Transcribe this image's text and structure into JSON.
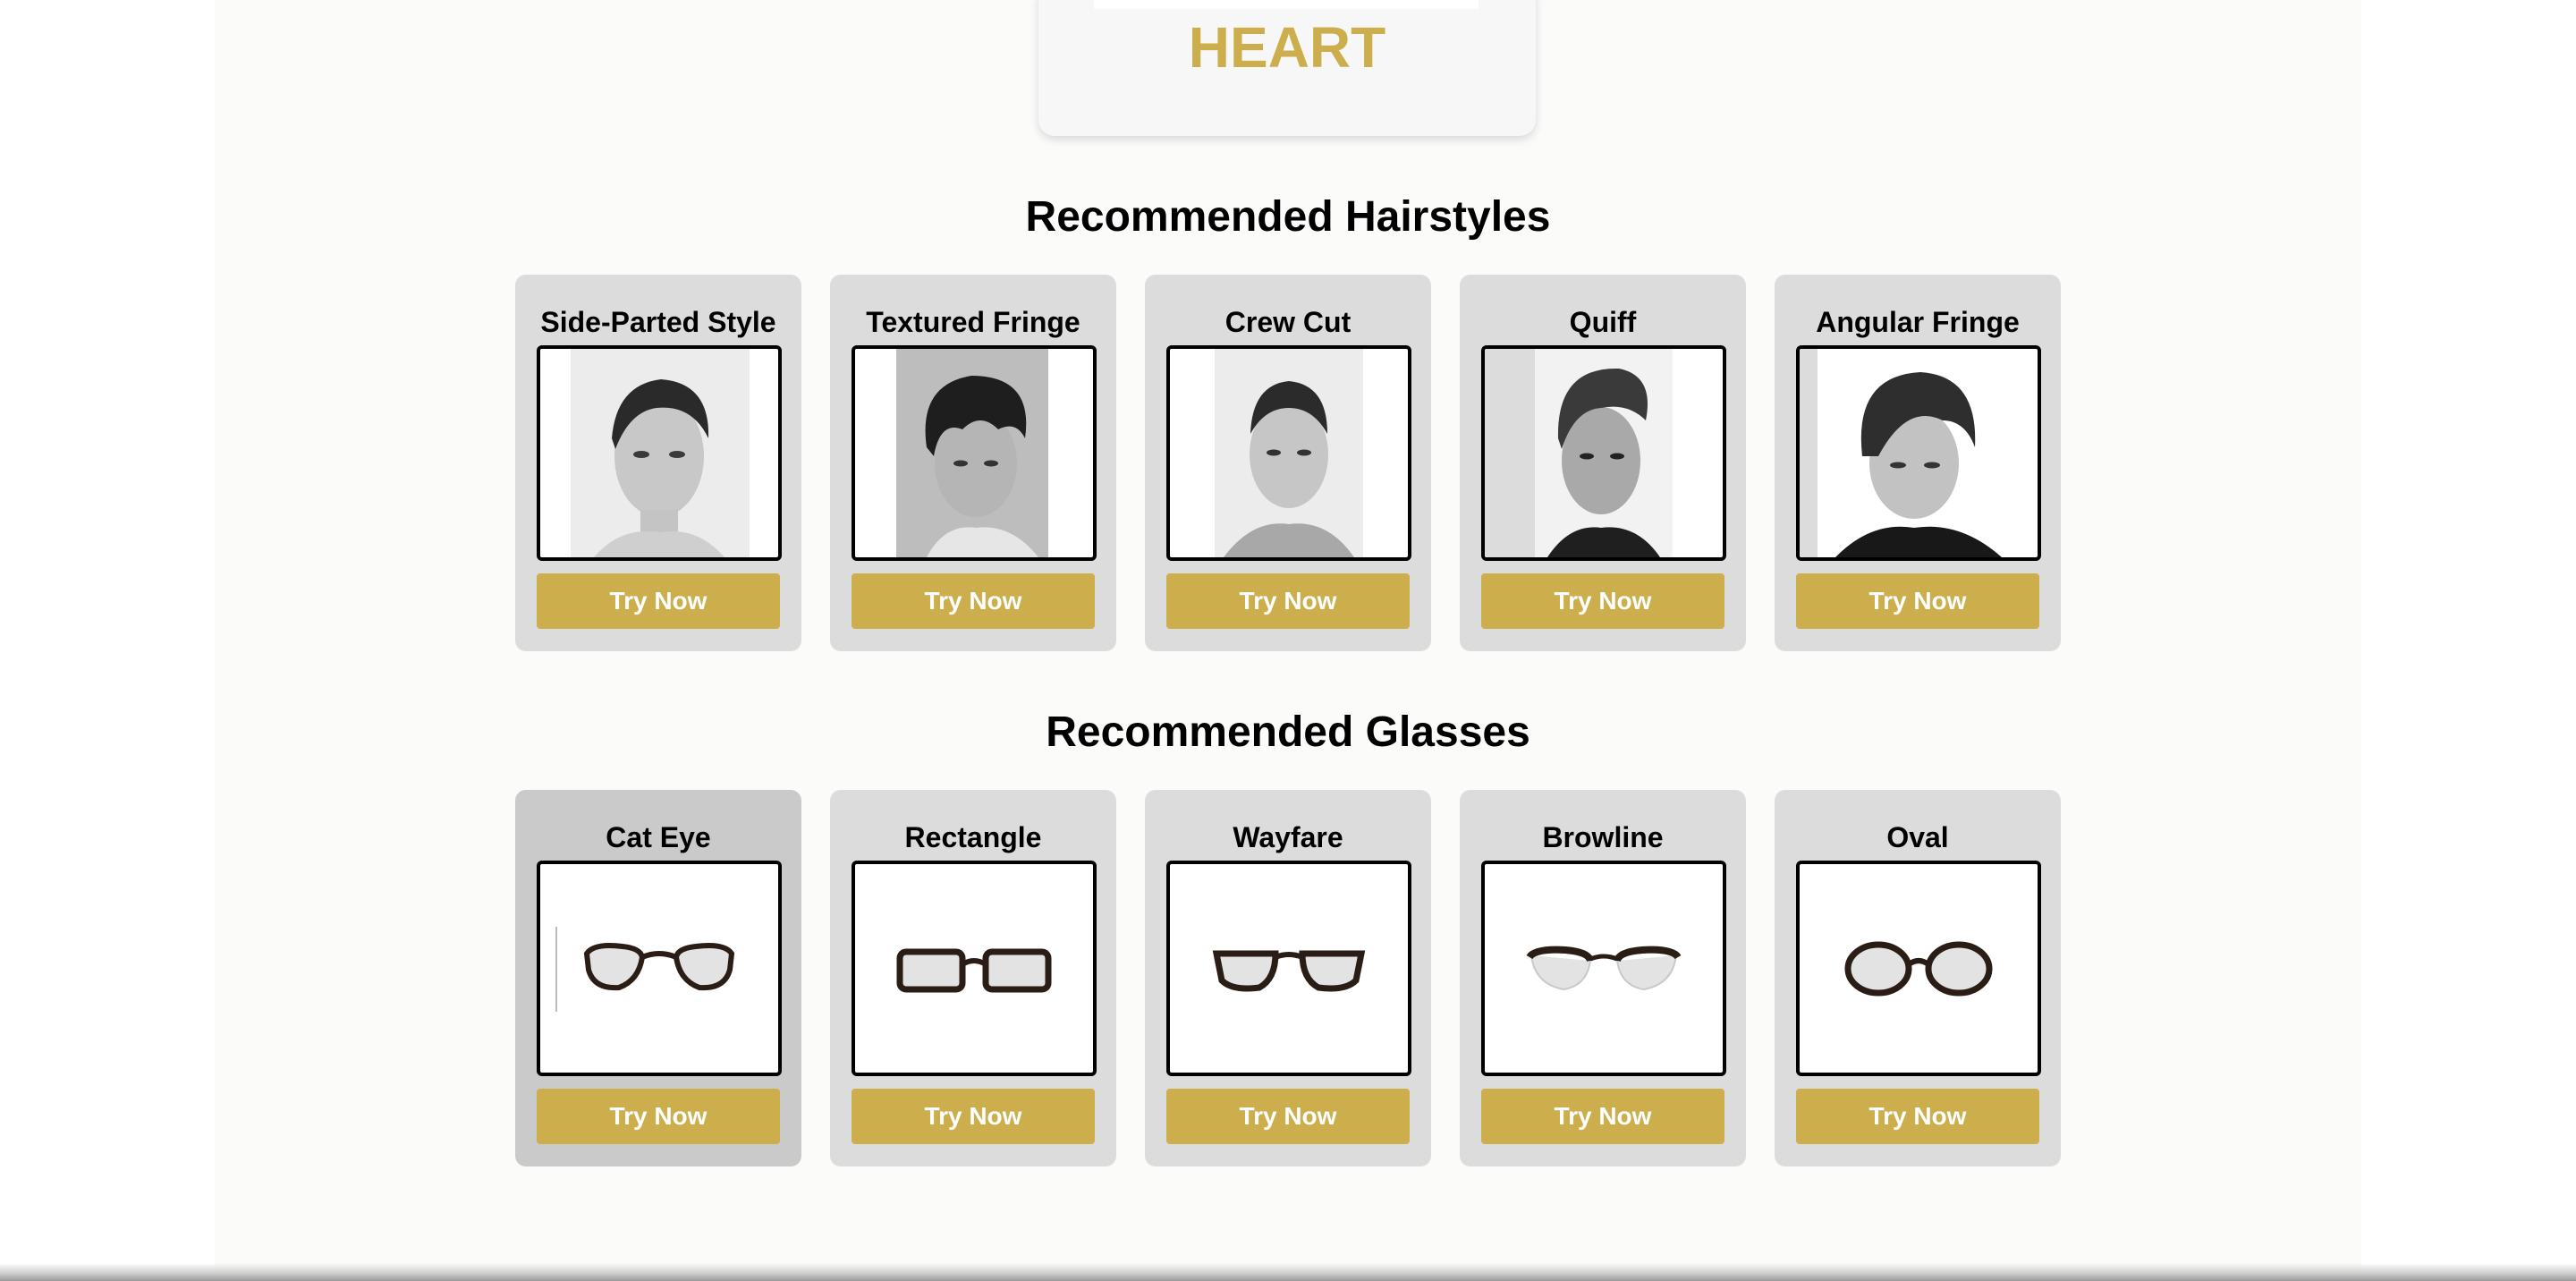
{
  "face_shape": {
    "label": "HEART"
  },
  "hairstyles": {
    "title": "Recommended Hairstyles",
    "items": [
      {
        "name": "Side-Parted Style",
        "button": "Try Now",
        "image": "side-parted-hairstyle-photo"
      },
      {
        "name": "Textured Fringe",
        "button": "Try Now",
        "image": "textured-fringe-hairstyle-photo"
      },
      {
        "name": "Crew Cut",
        "button": "Try Now",
        "image": "crew-cut-hairstyle-photo"
      },
      {
        "name": "Quiff",
        "button": "Try Now",
        "image": "quiff-hairstyle-photo"
      },
      {
        "name": "Angular Fringe",
        "button": "Try Now",
        "image": "angular-fringe-hairstyle-photo"
      }
    ]
  },
  "glasses": {
    "title": "Recommended Glasses",
    "items": [
      {
        "name": "Cat Eye",
        "button": "Try Now",
        "image": "cat-eye-glasses-icon",
        "selected": true
      },
      {
        "name": "Rectangle",
        "button": "Try Now",
        "image": "rectangle-glasses-icon"
      },
      {
        "name": "Wayfare",
        "button": "Try Now",
        "image": "wayfarer-glasses-icon"
      },
      {
        "name": "Browline",
        "button": "Try Now",
        "image": "browline-glasses-icon"
      },
      {
        "name": "Oval",
        "button": "Try Now",
        "image": "oval-glasses-icon"
      }
    ]
  },
  "colors": {
    "accent": "#cdae4c",
    "card": "#dcdcdc",
    "card_selected": "#cacaca",
    "page": "#fbfbfa"
  }
}
